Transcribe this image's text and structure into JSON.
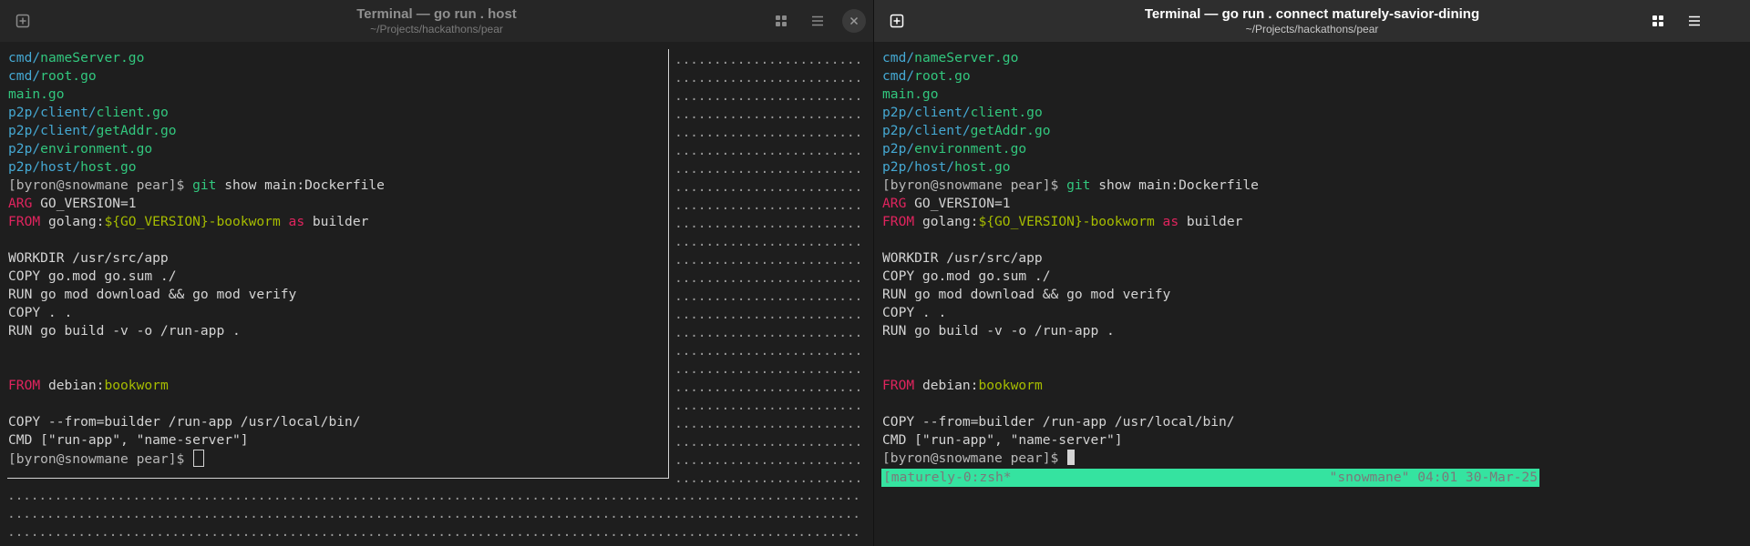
{
  "colors": {
    "dir": "#45a9d3",
    "file": "#32c77e",
    "keyword": "#e0245e",
    "variable": "#a6bc00",
    "status_bar": "#35e3a0"
  },
  "left": {
    "title": "Terminal — go run . host",
    "subtitle": "~/Projects/hackathons/pear",
    "icons": {
      "new_tab": "new-tab-icon",
      "split": "grid-icon",
      "menu": "hamburger-menu-icon",
      "close": "close-icon"
    },
    "listing": [
      {
        "dir": "cmd/",
        "file": "nameServer.go"
      },
      {
        "dir": "cmd/",
        "file": "root.go"
      },
      {
        "dir": "",
        "file": "main.go"
      },
      {
        "dir": "p2p/client/",
        "file": "client.go"
      },
      {
        "dir": "p2p/client/",
        "file": "getAddr.go"
      },
      {
        "dir": "p2p/",
        "file": "environment.go"
      },
      {
        "dir": "p2p/host/",
        "file": "host.go"
      }
    ],
    "prompt": "[byron@snowmane pear]$ ",
    "cmd": "git",
    "cmd_args": " show main:Dockerfile",
    "df": {
      "arg_kw": "ARG",
      "arg_rest": " GO_VERSION=1",
      "from1_kw": "FROM",
      "from1_img": " golang:",
      "from1_var": "${GO_VERSION}-bookworm",
      "from1_as": " as",
      "from1_name": " builder",
      "workdir": "WORKDIR /usr/src/app",
      "copy_mod": "COPY go.mod go.sum ./",
      "run_dl": "RUN go mod download && go mod verify",
      "copy_all": "COPY . .",
      "run_build": "RUN go build -v -o /run-app .",
      "from2_kw": "FROM",
      "from2_img": " debian:",
      "from2_tag": "bookworm",
      "copy_from": "COPY --from=builder /run-app /usr/local/bin/",
      "cmd_line": "CMD [\"run-app\", \"name-server\"]"
    },
    "prompt_end": "[byron@snowmane pear]$ ",
    "dots_col": "..........................................",
    "dots_row": ".............................................................................................................................................................................................................."
  },
  "right": {
    "title": "Terminal — go run . connect maturely-savior-dining",
    "subtitle": "~/Projects/hackathons/pear",
    "icons": {
      "new_tab": "new-tab-icon",
      "split": "grid-icon",
      "menu": "hamburger-menu-icon"
    },
    "listing": [
      {
        "dir": "cmd/",
        "file": "nameServer.go"
      },
      {
        "dir": "cmd/",
        "file": "root.go"
      },
      {
        "dir": "",
        "file": "main.go"
      },
      {
        "dir": "p2p/client/",
        "file": "client.go"
      },
      {
        "dir": "p2p/client/",
        "file": "getAddr.go"
      },
      {
        "dir": "p2p/",
        "file": "environment.go"
      },
      {
        "dir": "p2p/host/",
        "file": "host.go"
      }
    ],
    "prompt": "[byron@snowmane pear]$ ",
    "cmd": "git",
    "cmd_args": " show main:Dockerfile",
    "df": {
      "arg_kw": "ARG",
      "arg_rest": " GO_VERSION=1",
      "from1_kw": "FROM",
      "from1_img": " golang:",
      "from1_var": "${GO_VERSION}-bookworm",
      "from1_as": " as",
      "from1_name": " builder",
      "workdir": "WORKDIR /usr/src/app",
      "copy_mod": "COPY go.mod go.sum ./",
      "run_dl": "RUN go mod download && go mod verify",
      "copy_all": "COPY . .",
      "run_build": "RUN go build -v -o /run-app .",
      "from2_kw": "FROM",
      "from2_img": " debian:",
      "from2_tag": "bookworm",
      "copy_from": "COPY --from=builder /run-app /usr/local/bin/",
      "cmd_line": "CMD [\"run-app\", \"name-server\"]"
    },
    "prompt_end": "[byron@snowmane pear]$ ",
    "status_left": "[maturely-0:zsh*",
    "status_right": "\"snowmane\" 04:01 30-Mar-25"
  }
}
